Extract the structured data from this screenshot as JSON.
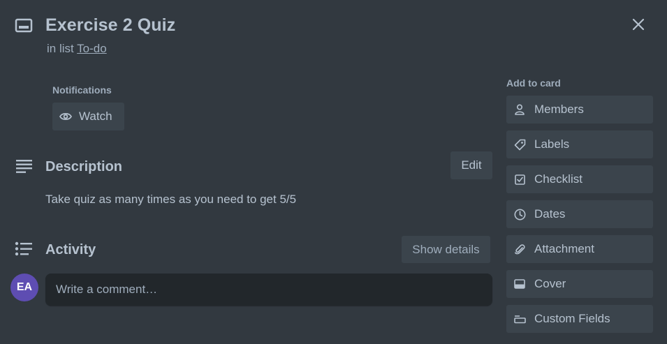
{
  "card": {
    "title": "Exercise 2 Quiz",
    "in_list_prefix": "in list",
    "list_name": "To-do"
  },
  "notifications": {
    "label": "Notifications",
    "watch_label": "Watch"
  },
  "description": {
    "heading": "Description",
    "edit_label": "Edit",
    "text": "Take quiz as many times as you need to get 5/5"
  },
  "activity": {
    "heading": "Activity",
    "show_details_label": "Show details",
    "avatar_initials": "EA",
    "comment_placeholder": "Write a comment…"
  },
  "sidebar": {
    "label": "Add to card",
    "items": [
      {
        "label": "Members",
        "icon": "person-icon"
      },
      {
        "label": "Labels",
        "icon": "tag-icon"
      },
      {
        "label": "Checklist",
        "icon": "checkbox-icon"
      },
      {
        "label": "Dates",
        "icon": "clock-icon"
      },
      {
        "label": "Attachment",
        "icon": "paperclip-icon"
      },
      {
        "label": "Cover",
        "icon": "cover-icon"
      },
      {
        "label": "Custom Fields",
        "icon": "custom-fields-icon"
      }
    ]
  },
  "colors": {
    "background": "#323940",
    "button": "#3b444c",
    "text": "#b6c2cf",
    "avatar": "#5e4db2",
    "comment_box": "#22272b"
  }
}
